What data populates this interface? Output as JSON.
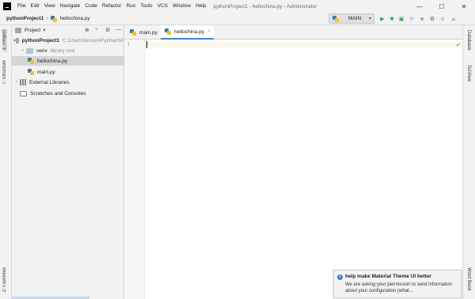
{
  "menubar": {
    "items": [
      "File",
      "Edit",
      "View",
      "Navigate",
      "Code",
      "Refactor",
      "Run",
      "Tools",
      "VCS",
      "Window",
      "Help"
    ],
    "window_title": "pythonProject1 - hellochina.py - Administrator",
    "controls": {
      "minimize": "—",
      "maximize": "☐",
      "close": "✕"
    }
  },
  "navbar": {
    "project": "pythonProject1",
    "separator": "›",
    "file": "hellochina.py",
    "run_config": "MAIN",
    "run_config_arrow": "▾",
    "tool_icons": {
      "run": "▶",
      "debug": "✱",
      "coverage": "▣",
      "profile": "⟳",
      "stop": "■",
      "search": "⌕"
    },
    "colors": {
      "run": "#2f9e4d",
      "debug": "#2f9e4d",
      "disabled": "#9a9a9a"
    }
  },
  "left_stripe": {
    "project_tab": "1: Project",
    "structure_tab": "7: Structure",
    "favorites_tab": "2: Favorites"
  },
  "right_stripe": {
    "database_tab": "Database",
    "sciview_tab": "SciView",
    "wordbook_tab": "Word Book"
  },
  "project_panel": {
    "title": "Project",
    "title_arrow": "▾",
    "header_buttons": {
      "locate": "⊕",
      "collapse": "÷",
      "settings": "⚙",
      "hide": "—"
    },
    "tree": {
      "root": {
        "label": "pythonProject1",
        "path": "C:\\Users\\lenovo\\PycharmP",
        "arrow": "▾"
      },
      "venv": {
        "label": "venv",
        "note": "library root",
        "arrow": "›"
      },
      "file1": "hellochina.py",
      "file2": "main.py",
      "external_libraries": {
        "label": "External Libraries",
        "arrow": "›"
      },
      "scratches": "Scratches and Consoles"
    }
  },
  "editor": {
    "tabs": [
      {
        "label": "main.py",
        "close": ""
      },
      {
        "label": "hellochina.py",
        "close": "×"
      }
    ],
    "line_number": "1",
    "check_icon": "✔"
  },
  "notification": {
    "icon": "i",
    "title": "help make Material Theme UI better",
    "body": "We are asking your permission to send information about your configuration (what..."
  },
  "colors": {
    "accent": "#4083c9",
    "selection": "#d5d5d5",
    "background": "#f2f2f2"
  }
}
